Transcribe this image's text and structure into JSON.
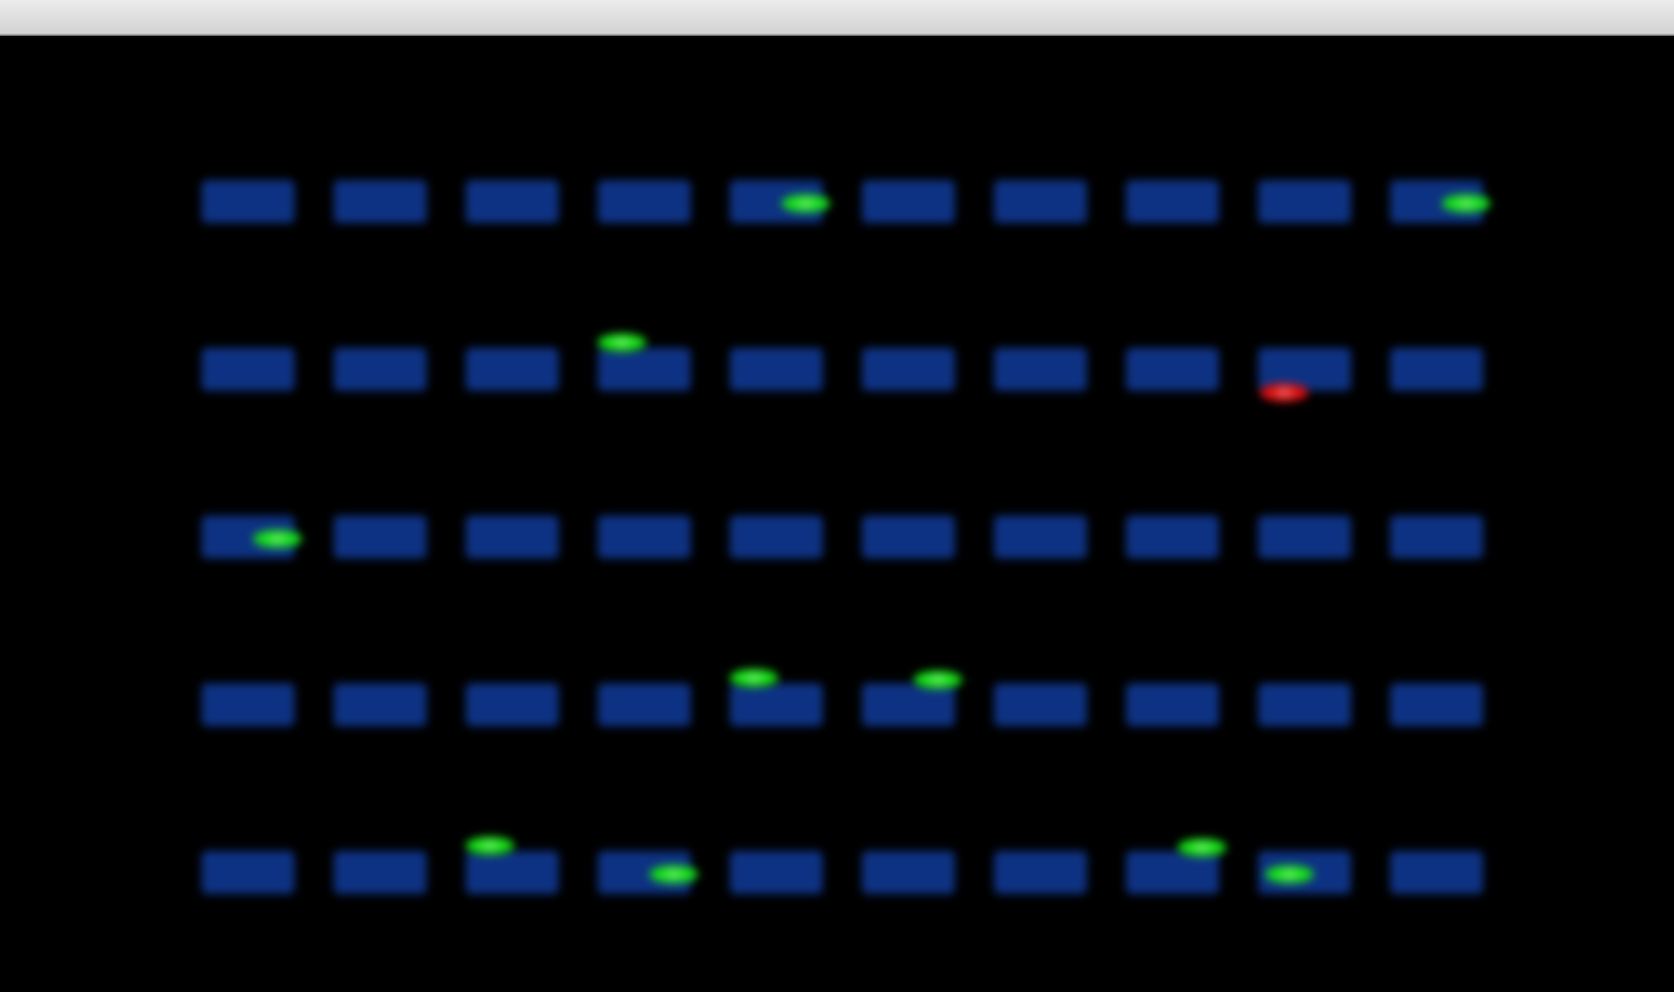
{
  "window": {
    "title": ""
  },
  "colors": {
    "background": "#000000",
    "block": "#0e3283",
    "friendly": "#16e016",
    "enemy": "#e01010"
  },
  "grid": {
    "rows": 5,
    "cols": 10
  },
  "markers": [
    {
      "type": "friendly",
      "row": 0,
      "col": 4,
      "offset": "lower-right"
    },
    {
      "type": "friendly",
      "row": 0,
      "col": 9,
      "offset": "lower-right"
    },
    {
      "type": "friendly",
      "row": 1,
      "col": 3,
      "offset": "upper-left"
    },
    {
      "type": "enemy",
      "row": 1,
      "col": 8,
      "offset": "below"
    },
    {
      "type": "friendly",
      "row": 2,
      "col": 0,
      "offset": "lower-right"
    },
    {
      "type": "friendly",
      "row": 3,
      "col": 4,
      "offset": "upper-left"
    },
    {
      "type": "friendly",
      "row": 3,
      "col": 5,
      "offset": "upper-right"
    },
    {
      "type": "friendly",
      "row": 4,
      "col": 2,
      "offset": "upper-left"
    },
    {
      "type": "friendly",
      "row": 4,
      "col": 3,
      "offset": "lower-right"
    },
    {
      "type": "friendly",
      "row": 4,
      "col": 7,
      "offset": "upper-right"
    },
    {
      "type": "friendly",
      "row": 4,
      "col": 8,
      "offset": "lower-left"
    }
  ]
}
